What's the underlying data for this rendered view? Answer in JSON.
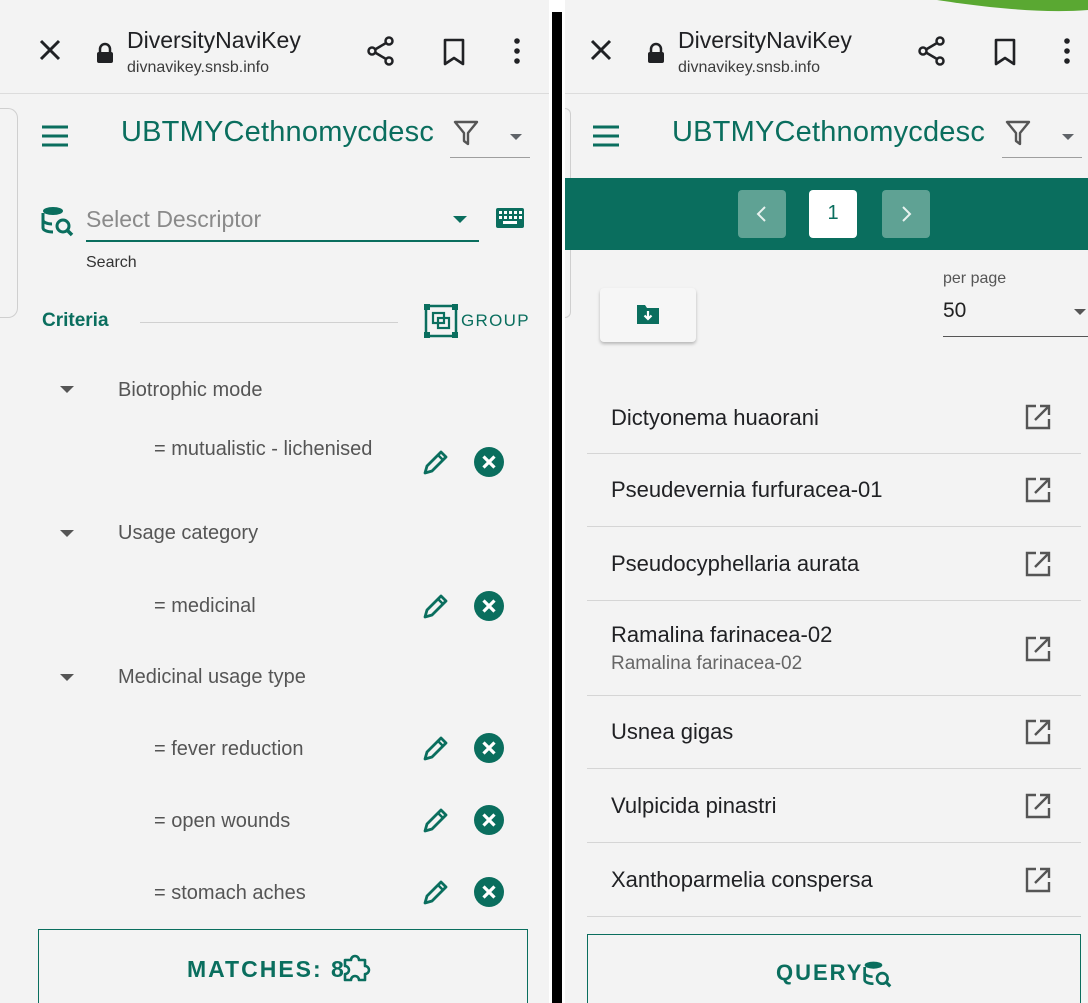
{
  "browser": {
    "site_title": "DiversityNaviKey",
    "site_url": "divnavikey.snsb.info"
  },
  "app": {
    "title": "UBTMYCethnomycdesc"
  },
  "left_panel": {
    "descriptor_placeholder": "Select Descriptor",
    "search_hint": "Search",
    "criteria_label": "Criteria",
    "group_label": "GROUP",
    "criteria": [
      {
        "name": "Biotrophic mode",
        "values": [
          "= mutualistic - lichenised"
        ]
      },
      {
        "name": "Usage category",
        "values": [
          "= medicinal"
        ]
      },
      {
        "name": "Medicinal usage type",
        "values": [
          "= fever reduction",
          "= open wounds",
          "= stomach aches"
        ]
      }
    ],
    "matches_label": "MATCHES: 8"
  },
  "right_panel": {
    "pager": {
      "current_page": "1"
    },
    "per_page_label": "per page",
    "per_page_value": "50",
    "results": [
      {
        "name": "Dictyonema huaorani",
        "sub": ""
      },
      {
        "name": "Pseudevernia furfuracea-01",
        "sub": ""
      },
      {
        "name": "Pseudocyphellaria aurata",
        "sub": ""
      },
      {
        "name": "Ramalina farinacea-02",
        "sub": "Ramalina farinacea-02"
      },
      {
        "name": "Usnea gigas",
        "sub": ""
      },
      {
        "name": "Vulpicida pinastri",
        "sub": ""
      },
      {
        "name": "Xanthoparmelia conspersa",
        "sub": ""
      }
    ],
    "query_label": "QUERY"
  },
  "colors": {
    "primary": "#0a6e5e",
    "background": "#f3f3f3",
    "pager_button": "#5fa294"
  },
  "icons": [
    "close-icon",
    "lock-icon",
    "share-icon",
    "bookmark-icon",
    "more-vert-icon",
    "menu-icon",
    "filter-icon",
    "descriptor-search-icon",
    "keyboard-icon",
    "group-icon",
    "edit-icon",
    "remove-icon",
    "puzzle-icon",
    "chevron-left-icon",
    "chevron-right-icon",
    "download-folder-icon",
    "open-external-icon",
    "query-icon"
  ]
}
